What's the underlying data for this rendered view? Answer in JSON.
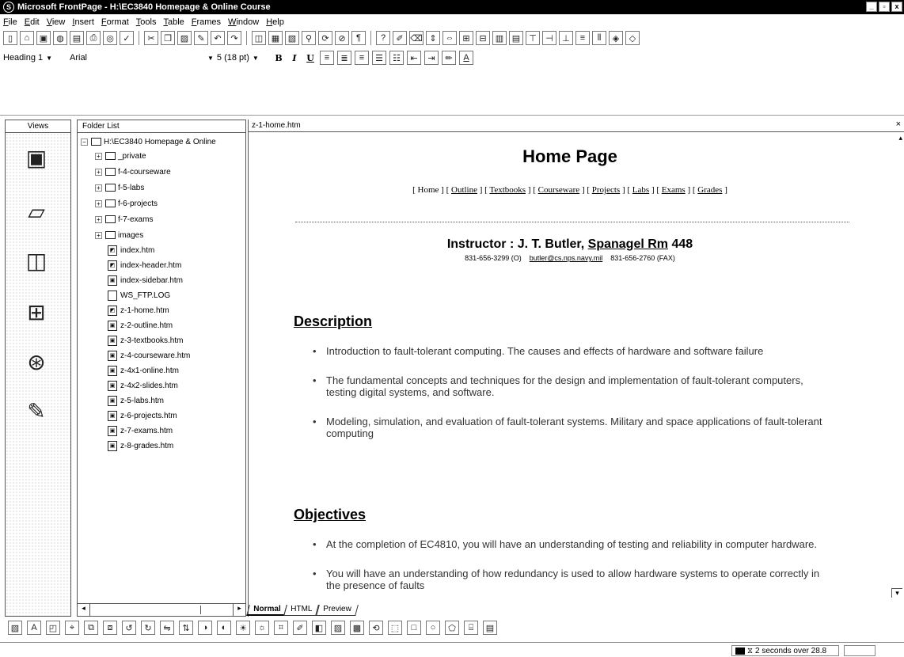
{
  "window": {
    "title": "Microsoft FrontPage - H:\\EC3840 Homepage & Online Course",
    "controls": [
      "_",
      "▫",
      "x"
    ]
  },
  "menu": [
    "File",
    "Edit",
    "View",
    "Insert",
    "Format",
    "Tools",
    "Table",
    "Frames",
    "Window",
    "Help"
  ],
  "formatting": {
    "style": "Heading 1",
    "font": "Arial",
    "size": "5 (18 pt)",
    "bold": "B",
    "italic": "I",
    "underline": "U"
  },
  "views_pane": {
    "header": "Views"
  },
  "folder_pane": {
    "header": "Folder List",
    "root": "H:\\EC3840 Homepage & Online",
    "folders": [
      "_private",
      "f-4-courseware",
      "f-5-labs",
      "f-6-projects",
      "f-7-exams",
      "images"
    ],
    "files": [
      "index.htm",
      "index-header.htm",
      "index-sidebar.htm",
      "WS_FTP.LOG",
      "z-1-home.htm",
      "z-2-outline.htm",
      "z-3-textbooks.htm",
      "z-4-courseware.htm",
      "z-4x1-online.htm",
      "z-4x2-slides.htm",
      "z-5-labs.htm",
      "z-6-projects.htm",
      "z-7-exams.htm",
      "z-8-grades.htm"
    ]
  },
  "editor": {
    "tab_label": "z-1-home.htm",
    "close": "×"
  },
  "document": {
    "title": "Home Page",
    "nav": [
      "Home",
      "Outline",
      "Textbooks",
      "Courseware",
      "Projects",
      "Labs",
      "Exams",
      "Grades"
    ],
    "instructor_label": "Instructor :",
    "instructor_name": "J. T. Butler,",
    "instructor_room": "Spanagel Rm",
    "instructor_room_num": "448",
    "phone": "831-656-3299 (O)",
    "email": "butler@cs.nps.navy.mil",
    "fax": "831-656-2760 (FAX)",
    "description_heading": "Description",
    "description": [
      "Introduction to fault-tolerant computing. The causes and effects of hardware and software failure",
      "The fundamental concepts and techniques for the design and implementation of fault-tolerant computers, testing digital systems, and software.",
      "Modeling, simulation, and evaluation of fault-tolerant systems. Military and space applications of fault-tolerant computing"
    ],
    "objectives_heading": "Objectives",
    "objectives": [
      "At the completion of EC4810, you will have an understanding of testing and reliability in computer hardware.",
      "You will have an understanding of how redundancy is used to allow hardware systems to operate correctly in the presence of faults"
    ]
  },
  "view_tabs": [
    "Normal",
    "HTML",
    "Preview"
  ],
  "status": {
    "download_time": "2 seconds over 28.8"
  }
}
